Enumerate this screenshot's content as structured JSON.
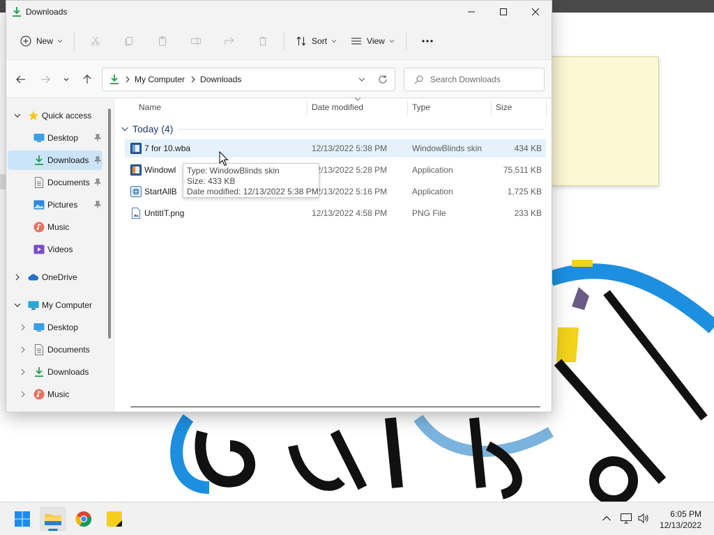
{
  "window": {
    "title": "Downloads"
  },
  "toolbar": {
    "new_label": "New",
    "sort_label": "Sort",
    "view_label": "View"
  },
  "address": {
    "crumbs": [
      "My Computer",
      "Downloads"
    ]
  },
  "search": {
    "placeholder": "Search Downloads"
  },
  "navpane": {
    "items": [
      {
        "label": "Quick access",
        "icon": "star-icon"
      },
      {
        "label": "Desktop",
        "icon": "desktop-folder-icon",
        "pinned": true
      },
      {
        "label": "Downloads",
        "icon": "download-icon",
        "pinned": true,
        "selected": true
      },
      {
        "label": "Documents",
        "icon": "documents-icon",
        "pinned": true
      },
      {
        "label": "Pictures",
        "icon": "pictures-icon",
        "pinned": true
      },
      {
        "label": "Music",
        "icon": "music-icon"
      },
      {
        "label": "Videos",
        "icon": "videos-icon"
      },
      {
        "label": "OneDrive",
        "icon": "cloud-icon"
      },
      {
        "label": "My Computer",
        "icon": "computer-icon"
      },
      {
        "label": "Desktop",
        "icon": "desktop-folder-icon"
      },
      {
        "label": "Documents",
        "icon": "documents-icon"
      },
      {
        "label": "Downloads",
        "icon": "download-icon"
      },
      {
        "label": "Music",
        "icon": "music-icon"
      }
    ]
  },
  "columns": {
    "name": "Name",
    "date": "Date modified",
    "type": "Type",
    "size": "Size"
  },
  "group": {
    "title": "Today (4)"
  },
  "files": [
    {
      "name": "7 for 10.wba",
      "date": "12/13/2022 5:38 PM",
      "type": "WindowBlinds skin",
      "size": "434 KB",
      "icon": "windowblinds-file-icon"
    },
    {
      "name": "Windowl",
      "date": "12/13/2022 5:28 PM",
      "type": "Application",
      "size": "75,511 KB",
      "icon": "application-icon"
    },
    {
      "name": "StartAllB",
      "date": "12/13/2022 5:16 PM",
      "type": "Application",
      "size": "1,725 KB",
      "icon": "application-icon"
    },
    {
      "name": "UntitIT.png",
      "date": "12/13/2022 4:58 PM",
      "type": "PNG File",
      "size": "233 KB",
      "icon": "image-file-icon"
    }
  ],
  "tooltip": {
    "type_line": "Type: WindowBlinds skin",
    "size_line": "Size: 433 KB",
    "date_line": "Date modified: 12/13/2022 5:38 PM"
  },
  "taskbar": {
    "apps": [
      "start-icon",
      "file-explorer-icon",
      "chrome-icon",
      "sticky-notes-icon"
    ]
  },
  "clock": {
    "time": "6:05 PM",
    "date": "12/13/2022"
  },
  "colors": {
    "accent": "#1a7fd6",
    "selection": "#cce4f7",
    "hover": "#e5f1fb",
    "download_green": "#1a9f4b"
  }
}
